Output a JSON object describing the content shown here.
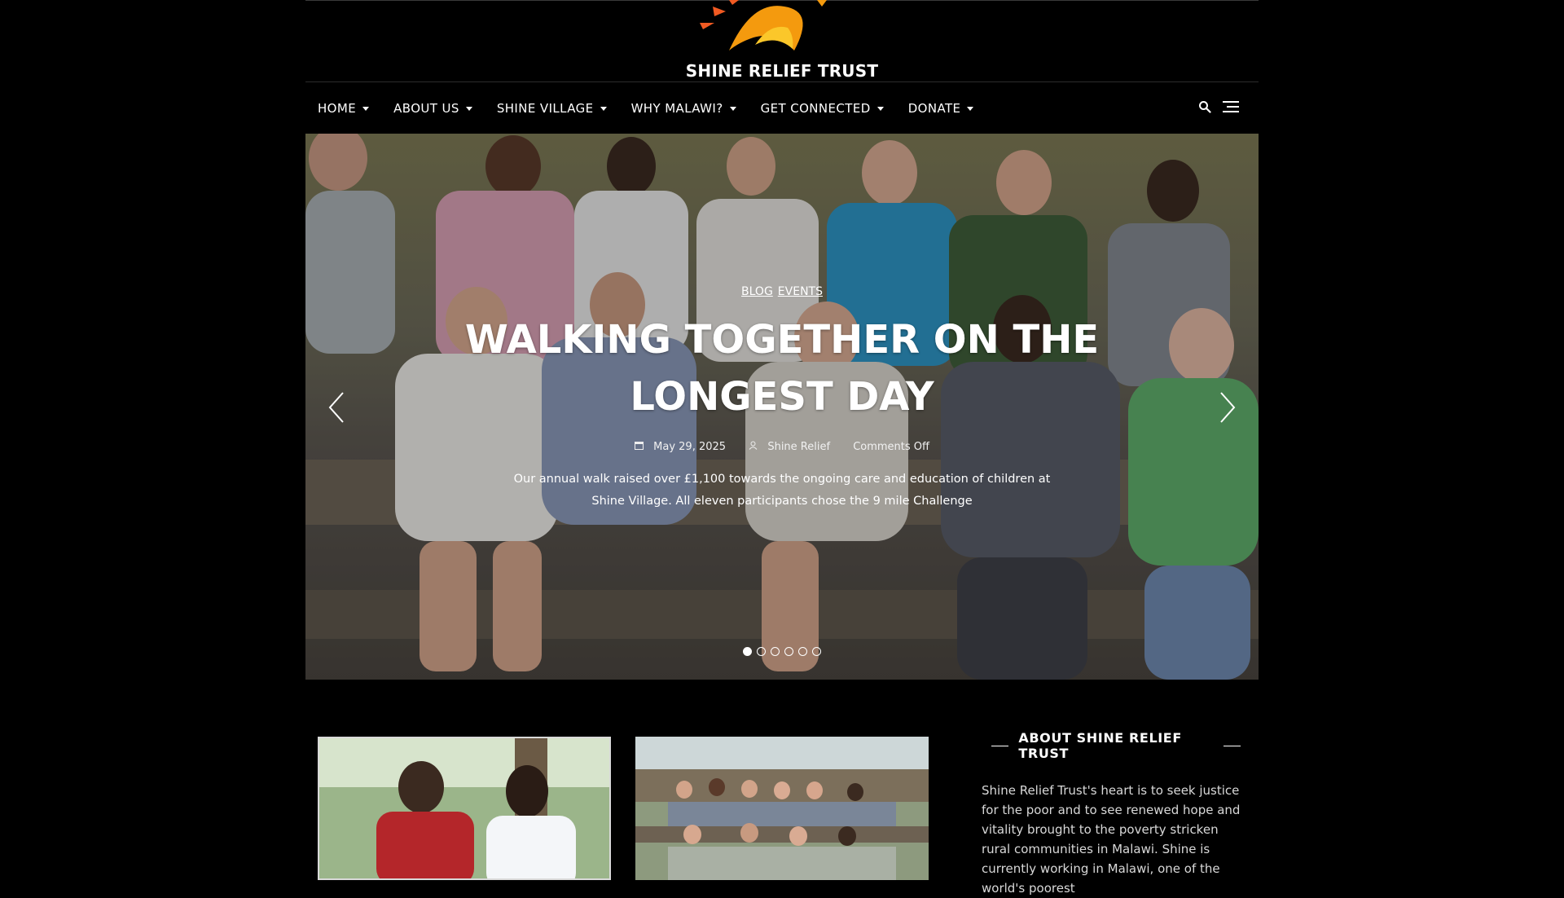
{
  "site": {
    "name": "SHINE RELIEF TRUST",
    "brand_colors": {
      "sun_orange": "#f49a0e",
      "sun_yellow": "#fbc72a",
      "ray_red": "#f15a22"
    }
  },
  "nav": {
    "items": [
      {
        "label": "HOME"
      },
      {
        "label": "ABOUT US"
      },
      {
        "label": "SHINE VILLAGE"
      },
      {
        "label": "WHY MALAWI?"
      },
      {
        "label": "GET CONNECTED"
      },
      {
        "label": "DONATE"
      }
    ],
    "icons": [
      "search-icon",
      "menu-icon"
    ]
  },
  "slider": {
    "categories": [
      "BLOG",
      "EVENTS"
    ],
    "title": "WALKING TOGETHER ON THE LONGEST DAY",
    "meta": {
      "date": "May 29, 2025",
      "author": "Shine Relief",
      "comments": "Comments Off"
    },
    "excerpt": "Our annual walk raised over £1,100 towards the ongoing care and education of children at Shine Village. All eleven participants chose the 9 mile Challenge",
    "slide_count": 6,
    "active_slide": 1
  },
  "sidebar": {
    "widget_title": "ABOUT SHINE RELIEF TRUST",
    "widget_text": "Shine Relief Trust's heart is to seek justice for the poor and to see renewed hope and vitality brought to the poverty stricken rural communities in Malawi. Shine is currently working in Malawi, one of the world's poorest"
  }
}
